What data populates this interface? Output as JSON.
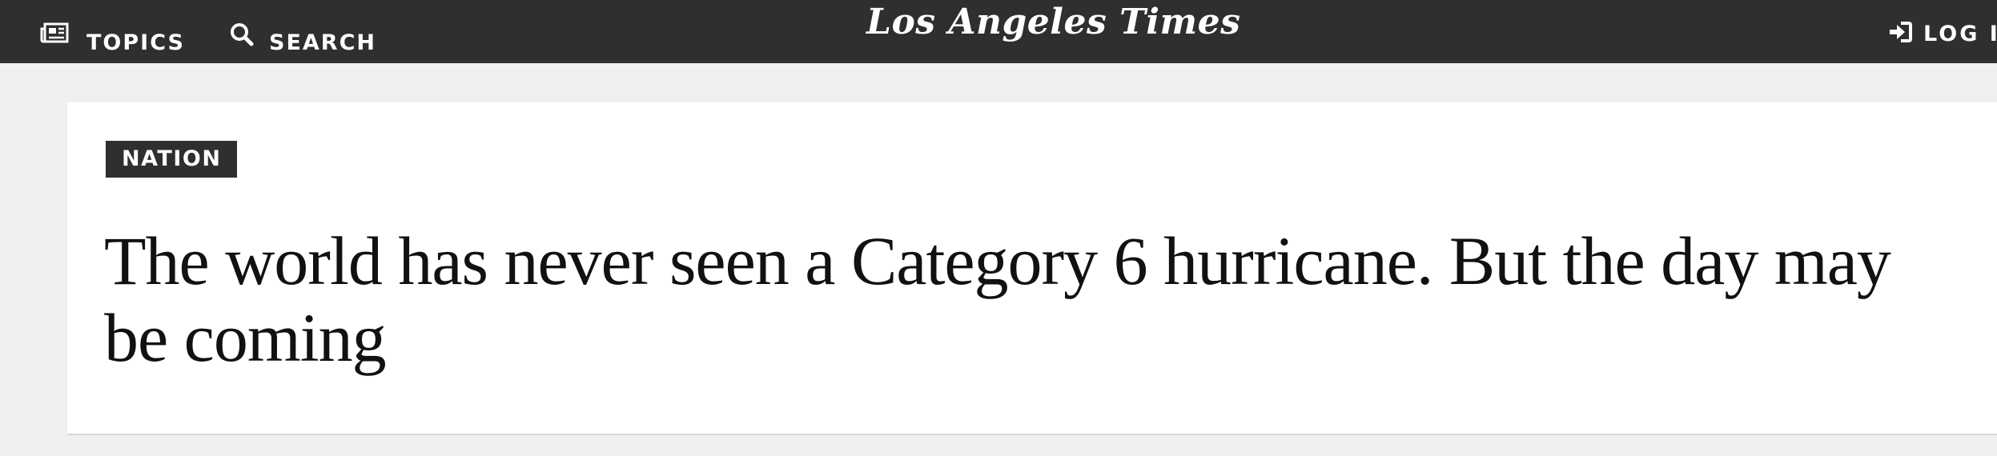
{
  "header": {
    "topics_label": "TOPICS",
    "search_label": "SEARCH",
    "logo_text": "Los Angeles Times",
    "login_label": "LOG I",
    "background_color": "#2f2f2f"
  },
  "article": {
    "section_badge": "NATION",
    "headline": "The world has never seen a Category 6 hurricane. But the day may be coming"
  },
  "icons": {
    "topics": "newspaper-icon",
    "search": "search-icon",
    "login": "sign-in-icon"
  }
}
